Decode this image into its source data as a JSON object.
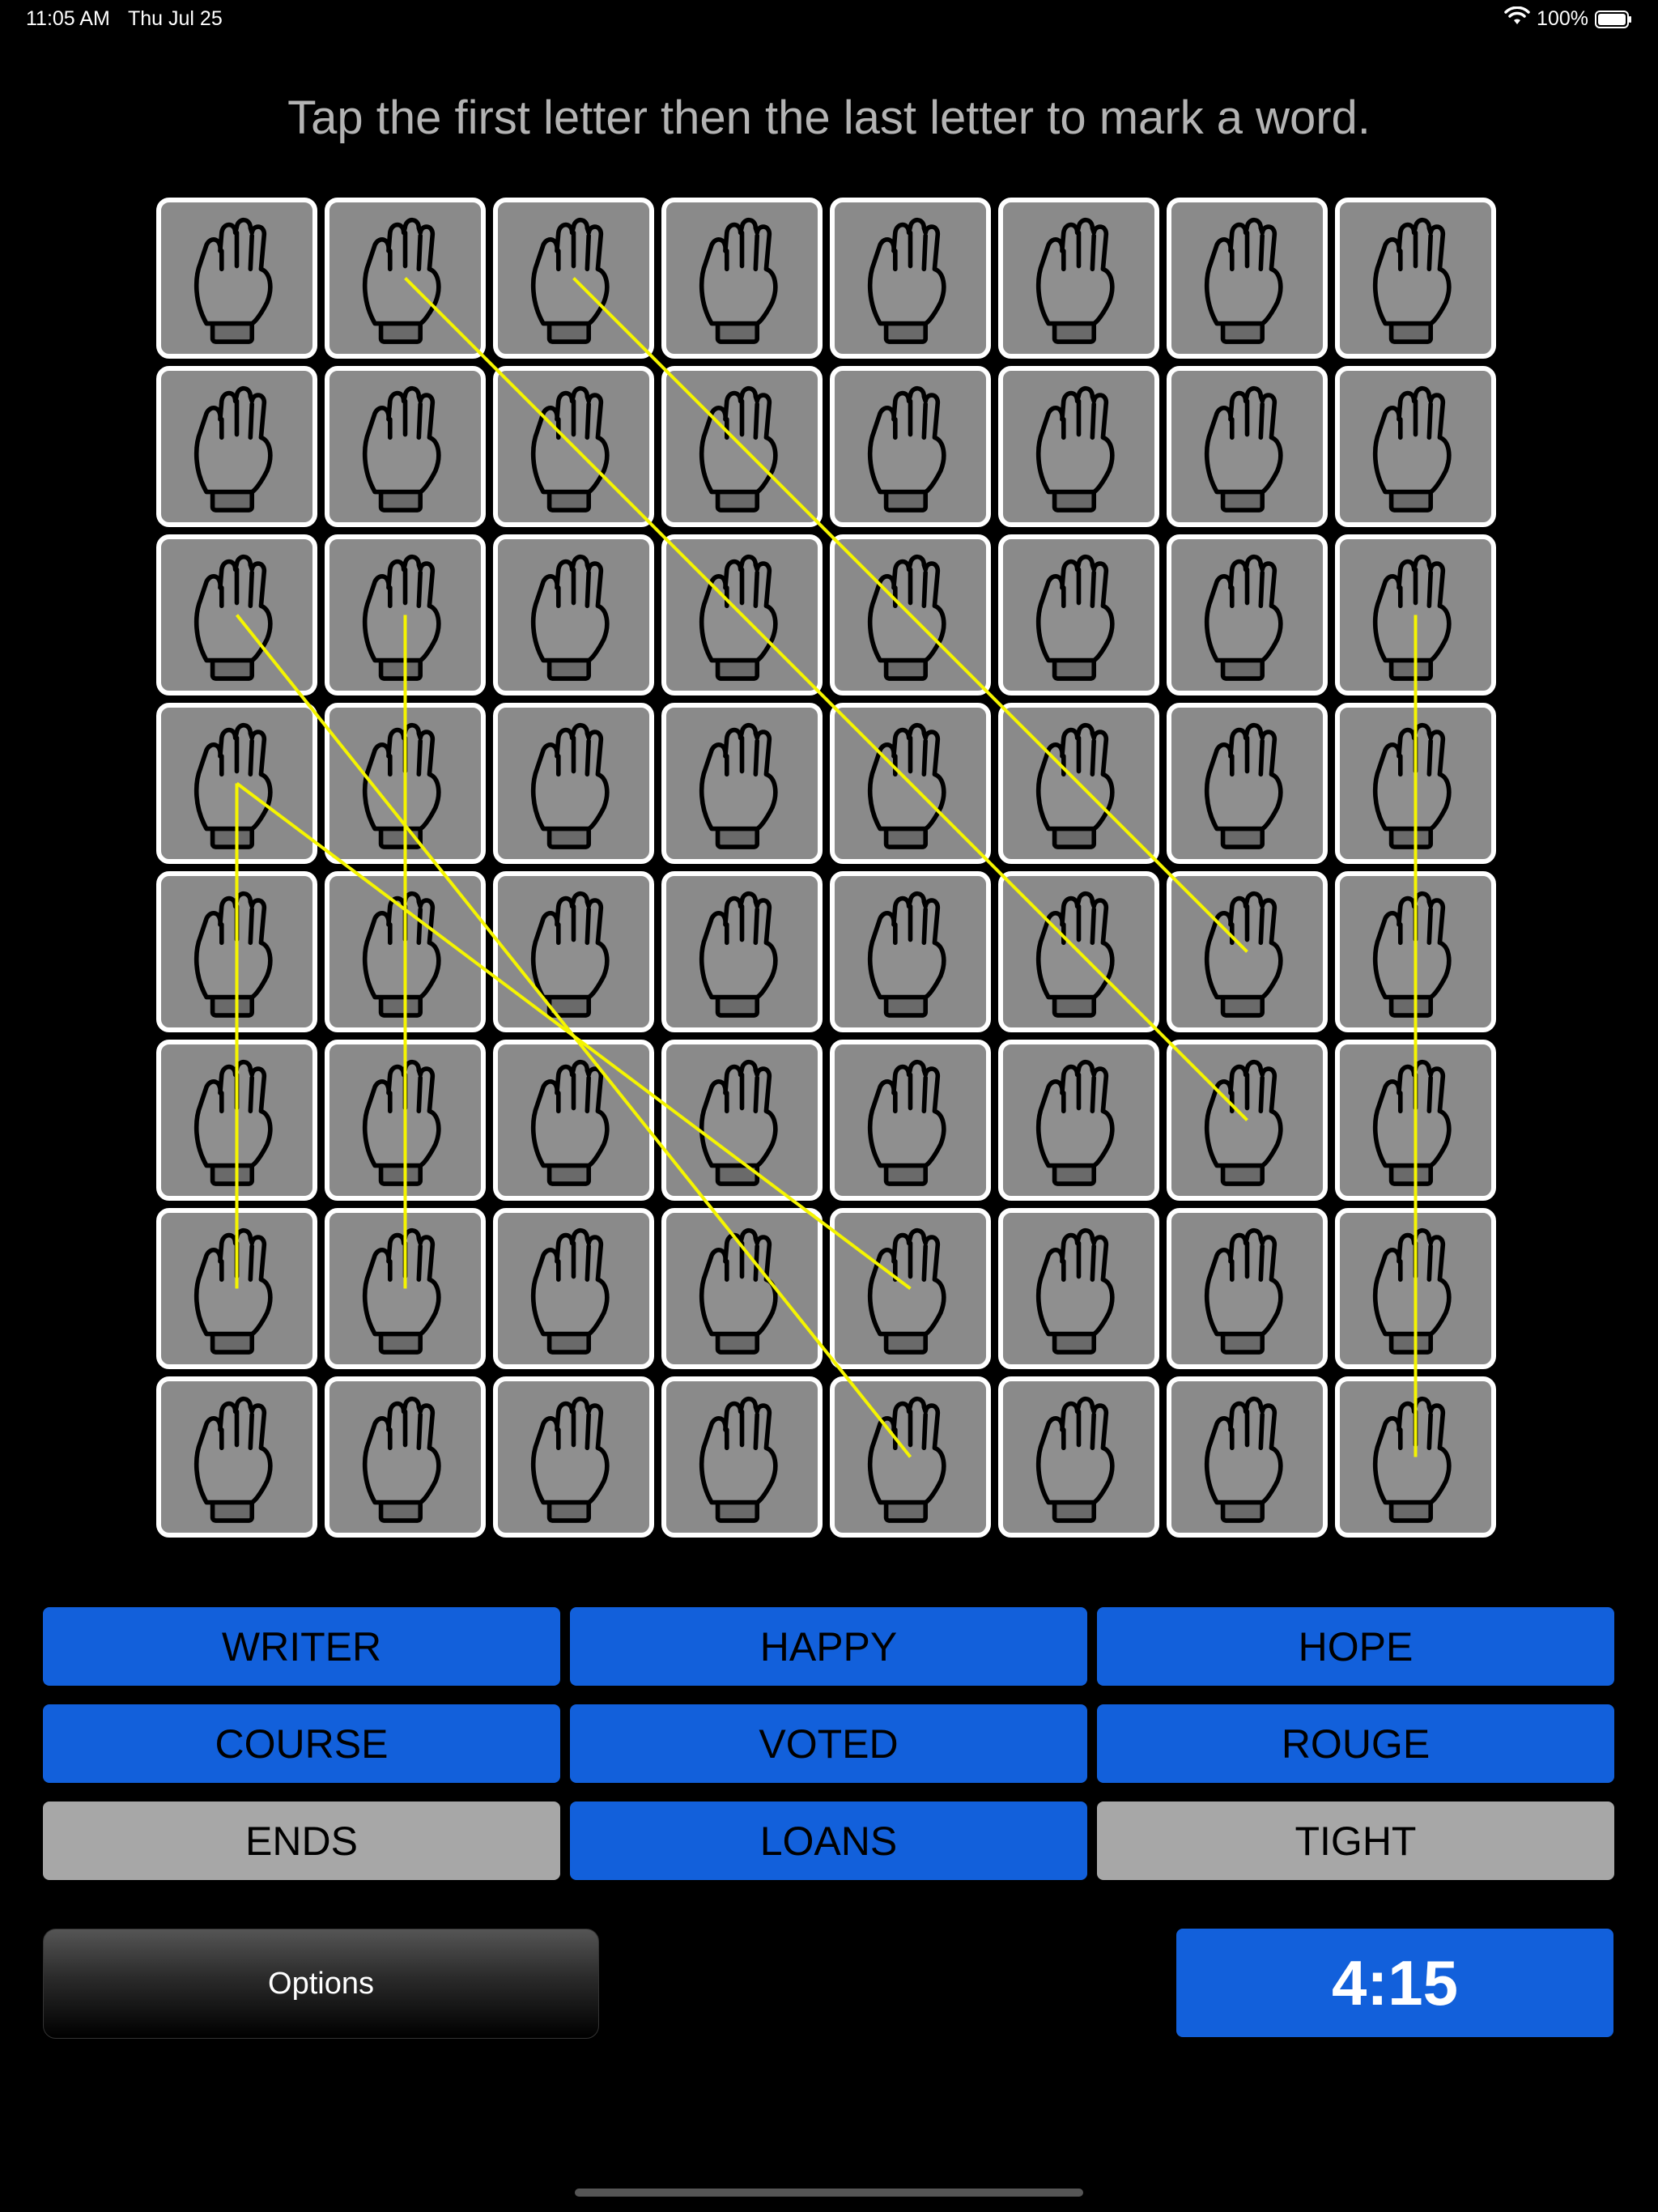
{
  "status": {
    "time": "11:05 AM",
    "date": "Thu Jul 25",
    "battery": "100%",
    "wifi_icon": "wifi-icon",
    "battery_icon": "battery-icon"
  },
  "instruction": "Tap the first letter then the last letter to mark a word.",
  "grid": {
    "rows": 8,
    "cols": 8,
    "tile_icon": "hand-sign-icon",
    "tile_color": "#8a8a8a",
    "line_color": "#f5f500",
    "marked_paths": [
      {
        "word": "WRITER",
        "from": [
          0,
          1
        ],
        "to": [
          5,
          6
        ]
      },
      {
        "word": "HAPPY",
        "from": [
          0,
          2
        ],
        "to": [
          4,
          6
        ]
      },
      {
        "word": "HOPE",
        "from": [
          2,
          1
        ],
        "to": [
          6,
          1
        ]
      },
      {
        "word": "COURSE",
        "from": [
          2,
          7
        ],
        "to": [
          7,
          7
        ]
      },
      {
        "word": "VOTED",
        "from": [
          2,
          0
        ],
        "to": [
          7,
          4
        ]
      },
      {
        "word": "ROUGE",
        "from": [
          3,
          0
        ],
        "to": [
          6,
          4
        ]
      },
      {
        "word": "LOANS",
        "from": [
          3,
          0
        ],
        "to": [
          6,
          0
        ]
      }
    ]
  },
  "words": [
    {
      "label": "WRITER",
      "found": true
    },
    {
      "label": "HAPPY",
      "found": true
    },
    {
      "label": "HOPE",
      "found": true
    },
    {
      "label": "COURSE",
      "found": true
    },
    {
      "label": "VOTED",
      "found": true
    },
    {
      "label": "ROUGE",
      "found": true
    },
    {
      "label": "ENDS",
      "found": false
    },
    {
      "label": "LOANS",
      "found": true
    },
    {
      "label": "TIGHT",
      "found": false
    }
  ],
  "colors": {
    "found": "#1260db",
    "pending": "#a7a7a7"
  },
  "options_label": "Options",
  "timer": "4:15"
}
